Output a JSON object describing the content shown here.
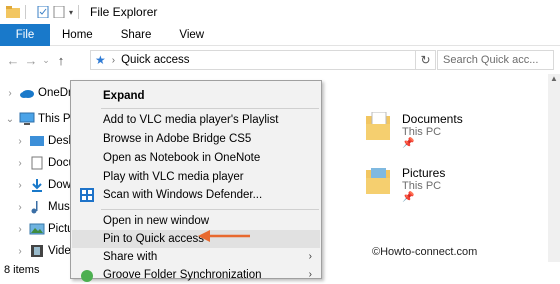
{
  "window": {
    "title": "File Explorer"
  },
  "ribbon": {
    "tabs": [
      "File",
      "Home",
      "Share",
      "View"
    ]
  },
  "address": {
    "path": "Quick access",
    "search_placeholder": "Search Quick acc..."
  },
  "nav_pane": {
    "items": [
      "OneDrive",
      "This PC",
      "Desktop",
      "Documents",
      "Downloads",
      "Music",
      "Pictures",
      "Videos"
    ]
  },
  "content": {
    "folders": [
      {
        "name": "Documents",
        "location": "This PC"
      },
      {
        "name": "Pictures",
        "location": "This PC"
      }
    ]
  },
  "context_menu": {
    "items": [
      "Expand",
      "Add to VLC media player's Playlist",
      "Browse in Adobe Bridge CS5",
      "Open as Notebook in OneNote",
      "Play with VLC media player",
      "Scan with Windows Defender...",
      "Open in new window",
      "Pin to Quick access",
      "Share with",
      "Groove Folder Synchronization"
    ]
  },
  "status": {
    "item_count": "8 items"
  },
  "watermark": "©Howto-connect.com",
  "colors": {
    "accent": "#1979ca",
    "arrow": "#e8692e",
    "folder": "#f2c661"
  }
}
